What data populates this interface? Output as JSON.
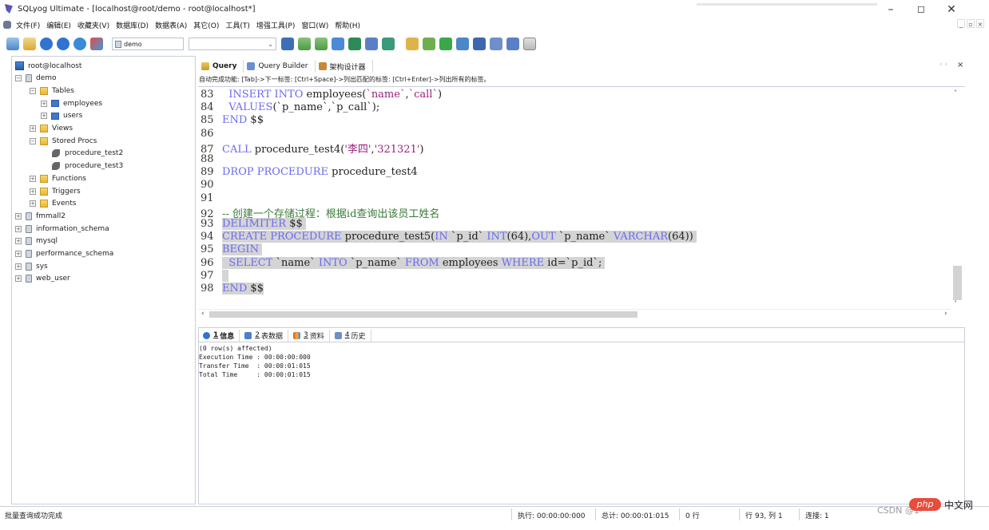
{
  "window": {
    "title": "SQLyog Ultimate - [localhost@root/demo - root@localhost*]",
    "minimize": "–",
    "maximize": "◻",
    "close": "✕"
  },
  "menu": [
    "文件(F)",
    "编辑(E)",
    "收藏夹(V)",
    "数据库(D)",
    "数据表(A)",
    "其它(O)",
    "工具(T)",
    "增强工具(P)",
    "窗口(W)",
    "帮助(H)"
  ],
  "toolbar": {
    "db_select": "demo"
  },
  "browser": {
    "items": [
      {
        "label": "root@localhost",
        "level": 0,
        "icon": "server-icon"
      },
      {
        "label": "demo",
        "level": 0,
        "icon": "database-icon",
        "exp": "⊟"
      },
      {
        "label": "Tables",
        "level": 1,
        "icon": "folder-icon",
        "exp": "⊟"
      },
      {
        "label": "employees",
        "level": 2,
        "icon": "table-icon",
        "exp": "⊞"
      },
      {
        "label": "users",
        "level": 2,
        "icon": "table-icon",
        "exp": "⊞"
      },
      {
        "label": "Views",
        "level": 1,
        "icon": "folder-icon",
        "exp": "⊞"
      },
      {
        "label": "Stored Procs",
        "level": 1,
        "icon": "folder-icon",
        "exp": "⊟"
      },
      {
        "label": "procedure_test2",
        "level": 2,
        "icon": "procedure-icon"
      },
      {
        "label": "procedure_test3",
        "level": 2,
        "icon": "procedure-icon"
      },
      {
        "label": "Functions",
        "level": 1,
        "icon": "folder-icon",
        "exp": "⊞"
      },
      {
        "label": "Triggers",
        "level": 1,
        "icon": "folder-icon",
        "exp": "⊞"
      },
      {
        "label": "Events",
        "level": 1,
        "icon": "folder-icon",
        "exp": "⊞"
      },
      {
        "label": "fmmall2",
        "level": 0,
        "icon": "database-icon",
        "exp": "⊞"
      },
      {
        "label": "information_schema",
        "level": 0,
        "icon": "database-icon",
        "exp": "⊞"
      },
      {
        "label": "mysql",
        "level": 0,
        "icon": "database-icon",
        "exp": "⊞"
      },
      {
        "label": "performance_schema",
        "level": 0,
        "icon": "database-icon",
        "exp": "⊞"
      },
      {
        "label": "sys",
        "level": 0,
        "icon": "database-icon",
        "exp": "⊞"
      },
      {
        "label": "web_user",
        "level": 0,
        "icon": "database-icon",
        "exp": "⊞"
      }
    ]
  },
  "query_tabs": [
    "Query",
    "Query Builder",
    "架构设计器"
  ],
  "hint": "自动完成功能: [Tab]->下一标签: [Ctrl+Space]->列出匹配的标签: [Ctrl+Enter]->列出所有的标签。",
  "code": {
    "lines": [
      {
        "n": "83",
        "parts": [
          {
            "t": "  "
          },
          {
            "t": "INSERT INTO",
            "c": "kw"
          },
          {
            "t": " employees("
          },
          {
            "t": "`name`",
            "c": "str"
          },
          {
            "t": ","
          },
          {
            "t": "`call`",
            "c": "str"
          },
          {
            "t": ")"
          }
        ]
      },
      {
        "n": "84",
        "parts": [
          {
            "t": "  "
          },
          {
            "t": "VALUES",
            "c": "kw"
          },
          {
            "t": "(`p_name`,`p_call`);"
          }
        ]
      },
      {
        "n": "85",
        "parts": [
          {
            "t": "END",
            "c": "kw"
          },
          {
            "t": " $$"
          }
        ]
      },
      {
        "n": "86",
        "parts": []
      },
      {
        "n": "87",
        "parts": [
          {
            "t": "CALL",
            "c": "kw"
          },
          {
            "t": " procedure_test4("
          },
          {
            "t": "'李四'",
            "c": "str"
          },
          {
            "t": ","
          },
          {
            "t": "'321321'",
            "c": "str"
          },
          {
            "t": ")"
          }
        ]
      },
      {
        "n": "88",
        "parts": []
      },
      {
        "n": "89",
        "parts": [
          {
            "t": "DROP PROCEDURE",
            "c": "kw"
          },
          {
            "t": " procedure_test4"
          }
        ]
      },
      {
        "n": "90",
        "parts": []
      },
      {
        "n": "91",
        "parts": []
      },
      {
        "n": "92",
        "parts": [
          {
            "t": "-- 创建一个存储过程：根据id查询出该员工姓名",
            "c": "cm"
          }
        ]
      },
      {
        "n": "93",
        "parts": [
          {
            "t": "DELIMITER",
            "c": "kw sel"
          },
          {
            "t": " $$ ",
            "c": "sel"
          }
        ]
      },
      {
        "n": "94",
        "parts": [
          {
            "t": "CREATE PROCEDURE",
            "c": "kw sel"
          },
          {
            "t": " procedure_test5(",
            "c": "sel"
          },
          {
            "t": "IN",
            "c": "kw sel"
          },
          {
            "t": " `p_id` ",
            "c": "sel"
          },
          {
            "t": "INT",
            "c": "kw sel"
          },
          {
            "t": "(64),",
            "c": "sel"
          },
          {
            "t": "OUT",
            "c": "kw sel"
          },
          {
            "t": " `p_name` ",
            "c": "sel"
          },
          {
            "t": "VARCHAR",
            "c": "kw sel"
          },
          {
            "t": "(64)) ",
            "c": "sel"
          }
        ]
      },
      {
        "n": "95",
        "parts": [
          {
            "t": "BEGIN",
            "c": "kw sel"
          },
          {
            "t": " ",
            "c": "sel"
          }
        ]
      },
      {
        "n": "96",
        "parts": [
          {
            "t": "  ",
            "c": "sel"
          },
          {
            "t": "SELECT",
            "c": "kw sel"
          },
          {
            "t": " `name` ",
            "c": "sel"
          },
          {
            "t": "INTO",
            "c": "kw sel"
          },
          {
            "t": " `p_name` ",
            "c": "sel"
          },
          {
            "t": "FROM",
            "c": "kw sel"
          },
          {
            "t": " employees ",
            "c": "sel"
          },
          {
            "t": "WHERE",
            "c": "kw sel"
          },
          {
            "t": " id=`p_id`; ",
            "c": "sel"
          }
        ]
      },
      {
        "n": "97",
        "parts": [
          {
            "t": "  ",
            "c": "sel"
          }
        ]
      },
      {
        "n": "98",
        "parts": [
          {
            "t": "END",
            "c": "kw sel"
          },
          {
            "t": " $$",
            "c": "sel"
          }
        ]
      }
    ]
  },
  "result_tabs": [
    {
      "key": "1",
      "label": "信息"
    },
    {
      "key": "2",
      "label": "表数据"
    },
    {
      "key": "3",
      "label": "资料"
    },
    {
      "key": "4",
      "label": "历史"
    }
  ],
  "output": "(0 row(s) affected)\nExecution Time : 00:00:00:000\nTransfer Time  : 00:00:01:015\nTotal Time     : 00:00:01:015",
  "status": {
    "message": "批量查询成功完成",
    "exec": "执行: 00:00:00:000",
    "total": "总计: 00:00:01:015",
    "rows": "0 行",
    "pos": "行 93, 列 1",
    "conn": "连接: 1"
  },
  "watermark": {
    "csdn": "CSDN @1̃‐'",
    "php": "php",
    "cn": "中文网"
  }
}
